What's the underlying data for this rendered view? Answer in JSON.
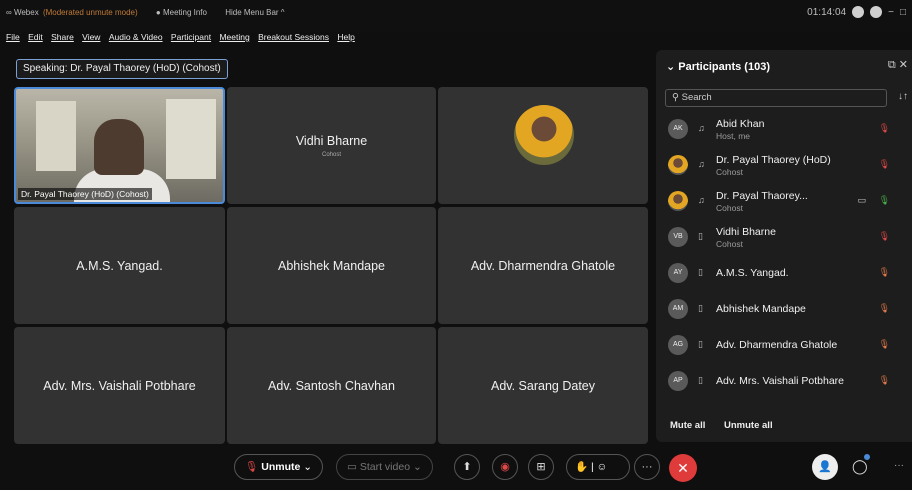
{
  "titlebar": {
    "app": "Webex",
    "mode": "(Moderated unmute mode)",
    "meeting_info": "Meeting Info",
    "hide_menu": "Hide Menu Bar ^",
    "time": "01:14:04"
  },
  "menu": [
    "File",
    "Edit",
    "Share",
    "View",
    "Audio & Video",
    "Participant",
    "Meeting",
    "Breakout Sessions",
    "Help"
  ],
  "speaking": "Speaking: Dr. Payal Thaorey (HoD) (Cohost)",
  "tiles": [
    {
      "name": "Dr. Payal Thaorey (HoD) (Cohost)",
      "sub": ""
    },
    {
      "name": "Vidhi Bharne",
      "sub": "Cohost"
    },
    {
      "name": "",
      "sub": ""
    },
    {
      "name": "A.M.S. Yangad.",
      "sub": ""
    },
    {
      "name": "Abhishek Mandape",
      "sub": ""
    },
    {
      "name": "Adv. Dharmendra Ghatole",
      "sub": ""
    },
    {
      "name": "Adv. Mrs. Vaishali Potbhare",
      "sub": ""
    },
    {
      "name": "Adv. Santosh Chavhan",
      "sub": ""
    },
    {
      "name": "Adv. Sarang Datey",
      "sub": ""
    }
  ],
  "panel": {
    "title": "Participants (103)",
    "search_placeholder": "Search",
    "participants": [
      {
        "initials": "AK",
        "name": "Abid Khan",
        "role": "Host, me"
      },
      {
        "initials": "",
        "name": "Dr. Payal Thaorey (HoD)",
        "role": "Cohost"
      },
      {
        "initials": "",
        "name": "Dr. Payal Thaorey...",
        "role": "Cohost"
      },
      {
        "initials": "VB",
        "name": "Vidhi Bharne",
        "role": "Cohost"
      },
      {
        "initials": "AY",
        "name": "A.M.S. Yangad.",
        "role": ""
      },
      {
        "initials": "AM",
        "name": "Abhishek Mandape",
        "role": ""
      },
      {
        "initials": "AG",
        "name": "Adv. Dharmendra Ghatole",
        "role": ""
      },
      {
        "initials": "AP",
        "name": "Adv. Mrs. Vaishali Potbhare",
        "role": ""
      }
    ],
    "mute_all": "Mute all",
    "unmute_all": "Unmute all"
  },
  "toolbar": {
    "unmute": "Unmute",
    "start_video": "Start video"
  }
}
